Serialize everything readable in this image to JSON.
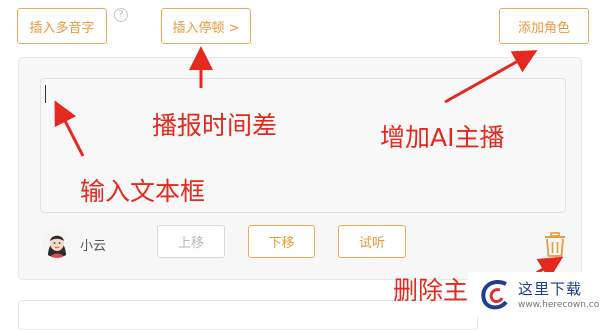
{
  "toolbar": {
    "insert_polyphone_label": "插入多音字",
    "help_label": "?",
    "insert_pause_label": "插入停顿 >",
    "add_role_label": "添加角色"
  },
  "editor": {
    "text_value": ""
  },
  "voice": {
    "name": "小云",
    "avatar_icon": "girl-avatar-icon"
  },
  "actions": {
    "move_up_label": "上移",
    "move_down_label": "下移",
    "preview_label": "试听",
    "delete_icon": "trash-icon"
  },
  "annotations": {
    "pause_label": "播报时间差",
    "add_anchor_label": "增加AI主播",
    "textbox_label": "输入文本框",
    "delete_label": "删除主"
  },
  "watermark": {
    "text": "这里下载",
    "url": "www.herecown.com"
  },
  "colors": {
    "accent": "#e89a3e",
    "annotation": "#e4291f"
  }
}
